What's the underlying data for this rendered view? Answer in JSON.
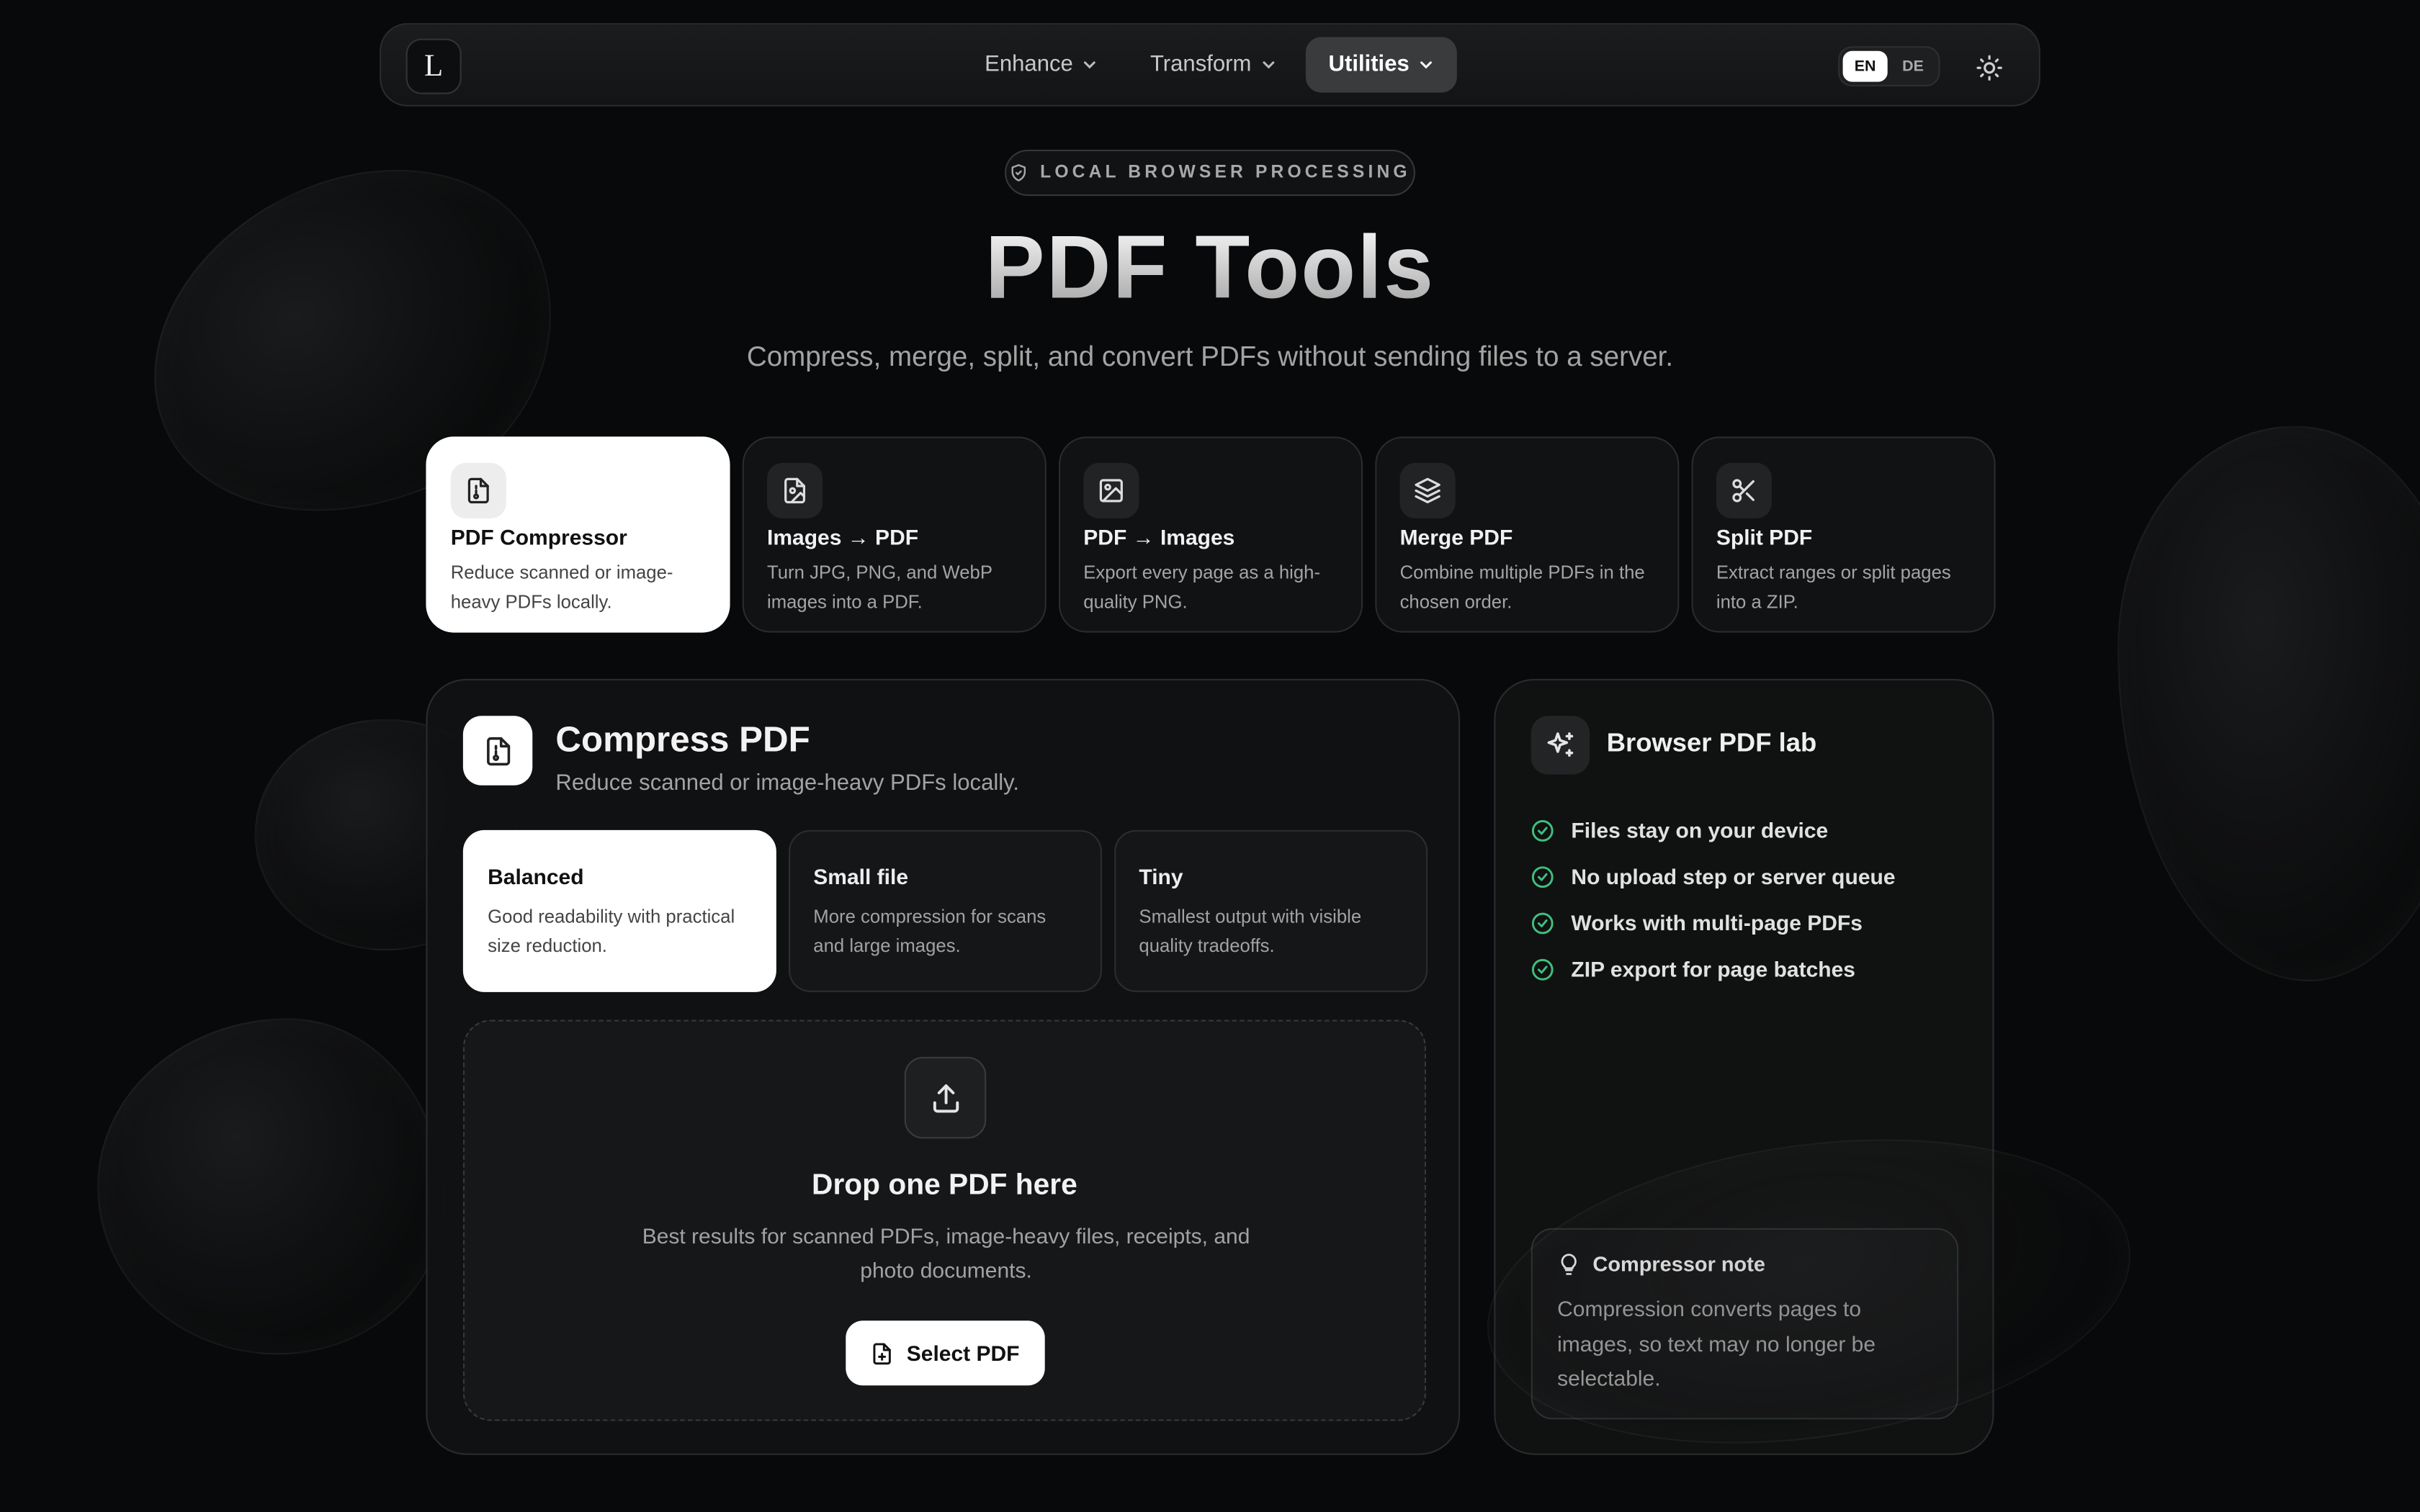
{
  "nav": {
    "logo_letter": "L",
    "menu": [
      {
        "label": "Enhance",
        "active": false
      },
      {
        "label": "Transform",
        "active": false
      },
      {
        "label": "Utilities",
        "active": true
      }
    ],
    "languages": [
      "EN",
      "DE"
    ],
    "active_language": "EN",
    "theme_icon": "sun-icon"
  },
  "hero": {
    "badge": "LOCAL BROWSER PROCESSING",
    "title": "PDF Tools",
    "subtitle": "Compress, merge, split, and convert PDFs without sending files to a server."
  },
  "tools": [
    {
      "title": "PDF Compressor",
      "desc": "Reduce scanned or image-heavy PDFs locally.",
      "icon": "file-compress-icon",
      "selected": true
    },
    {
      "title": "Images → PDF",
      "desc": "Turn JPG, PNG, and WebP images into a PDF.",
      "icon": "file-image-icon",
      "selected": false
    },
    {
      "title": "PDF → Images",
      "desc": "Export every page as a high-quality PNG.",
      "icon": "image-icon",
      "selected": false
    },
    {
      "title": "Merge PDF",
      "desc": "Combine multiple PDFs in the chosen order.",
      "icon": "layers-icon",
      "selected": false
    },
    {
      "title": "Split PDF",
      "desc": "Extract ranges or split pages into a ZIP.",
      "icon": "scissors-icon",
      "selected": false
    }
  ],
  "panel": {
    "title": "Compress PDF",
    "subtitle": "Reduce scanned or image-heavy PDFs locally.",
    "modes": [
      {
        "title": "Balanced",
        "desc": "Good readability with practical size reduction.",
        "selected": true
      },
      {
        "title": "Small file",
        "desc": "More compression for scans and large images.",
        "selected": false
      },
      {
        "title": "Tiny",
        "desc": "Smallest output with visible quality tradeoffs.",
        "selected": false
      }
    ],
    "drop": {
      "title": "Drop one PDF here",
      "desc": "Best results for scanned PDFs, image-heavy files, receipts, and photo documents.",
      "button": "Select PDF"
    }
  },
  "side": {
    "title": "Browser PDF lab",
    "features": [
      "Files stay on your device",
      "No upload step or server queue",
      "Works with multi-page PDFs",
      "ZIP export for page batches"
    ],
    "note_title": "Compressor note",
    "note_text": "Compression converts pages to images, so text may no longer be selectable."
  },
  "colors": {
    "background": "#08090a",
    "accent_check": "#3fbf7f",
    "selected_card": "#ffffff"
  }
}
